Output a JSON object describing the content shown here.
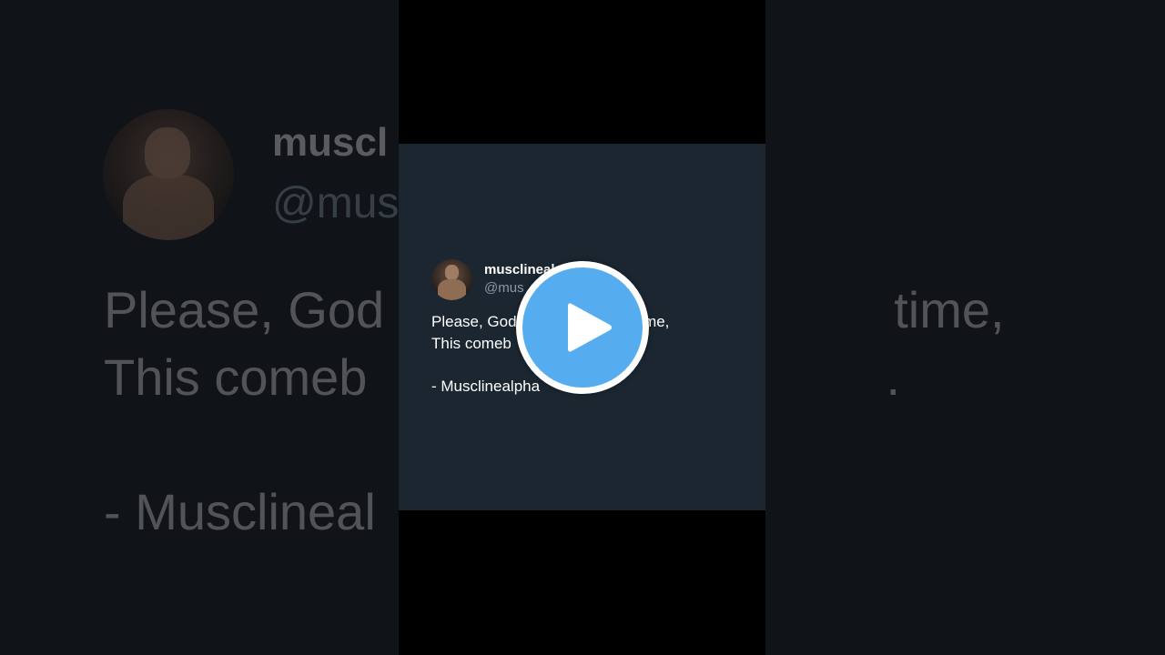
{
  "background": {
    "name_fragment": "muscl",
    "handle_fragment": "@mus",
    "line1": "Please, God                                time,",
    "line2": "This comeb                                 .",
    "signature_fragment": "- Muscl‍ineal"
  },
  "tweet": {
    "display_name_visible": "musclineal",
    "handle_visible": "@mus",
    "line1_left": "Please, God",
    "line1_right": "time,",
    "line2_left": "This comeb",
    "signature": "- Musclinealpha",
    "card_color": "#1b2630"
  },
  "play_button": {
    "icon": "play-icon",
    "color": "#55acee"
  }
}
